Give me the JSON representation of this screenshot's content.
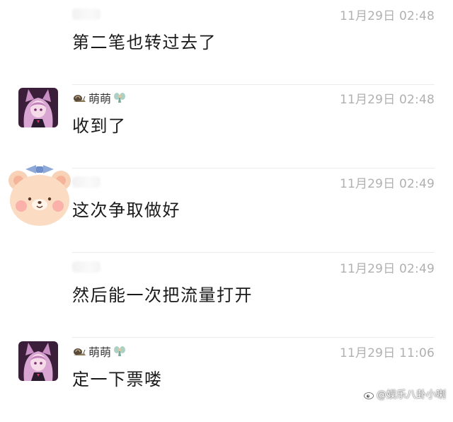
{
  "messages": [
    {
      "sender": "",
      "avatar_icon": "",
      "time": "11月29日 02:48",
      "text": "第二笔也转过去了"
    },
    {
      "sender": "萌萌",
      "avatar_icon": "anime-girl-avatar",
      "time": "11月29日 02:48",
      "text": "收到了"
    },
    {
      "sender": "",
      "avatar_icon": "bear-avatar",
      "time": "11月29日 02:49",
      "text": "这次争取做好"
    },
    {
      "sender": "",
      "avatar_icon": "",
      "time": "11月29日 02:49",
      "text": "然后能一次把流量打开"
    },
    {
      "sender": "萌萌",
      "avatar_icon": "anime-girl-avatar",
      "time": "11月29日 11:06",
      "text": "定一下票喽"
    }
  ],
  "watermark": {
    "text": "@娱乐八卦小喇",
    "icon": "weibo-logo-icon"
  },
  "colors": {
    "time": "#b0b0b0",
    "text": "#1a1a1a",
    "divider": "#ececec"
  }
}
